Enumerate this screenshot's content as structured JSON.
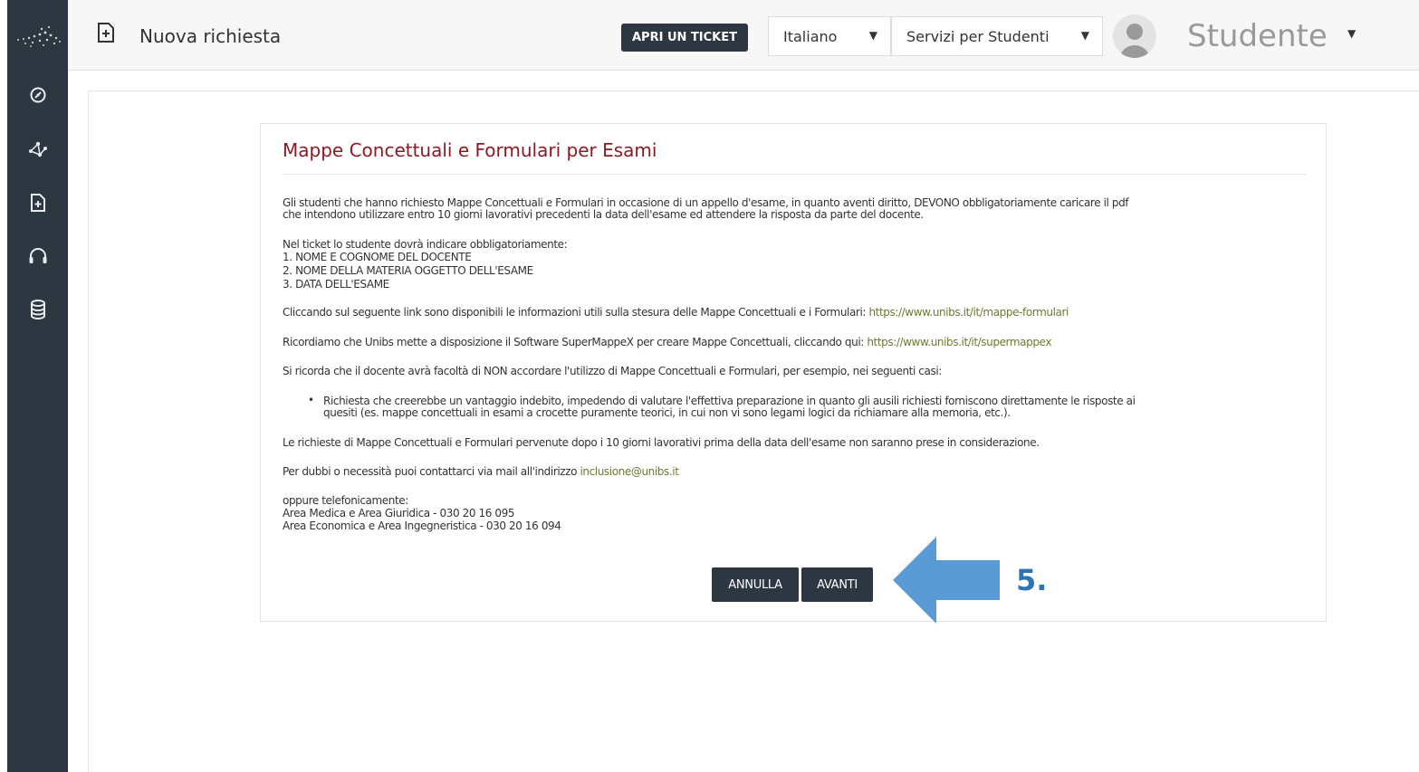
{
  "header": {
    "title": "Nuova richiesta",
    "ticket_button": "APRI UN TICKET",
    "language_select": "Italiano",
    "service_select": "Servizi per Studenti",
    "user_name": "Studente"
  },
  "panel": {
    "title": "Mappe Concettuali e Formulari per Esami",
    "intro_line1": "Gli studenti che hanno richiesto Mappe Concettuali e Formulari in occasione di un appello d'esame, in quanto aventi diritto, DEVONO obbligatoriamente caricare il pdf",
    "intro_line2": "che intendono utilizzare entro 10 giorni lavorativi precedenti la data dell'esame ed attendere la risposta da parte del docente.",
    "ticket_heading": "Nel ticket lo studente dovrà indicare obbligatoriamente:",
    "ticket_item1": "1. NOME E COGNOME DEL DOCENTE",
    "ticket_item2": "2. NOME DELLA MATERIA OGGETTO DELL'ESAME",
    "ticket_item3": "3. DATA DELL'ESAME",
    "info_text": "Cliccando sul seguente link sono disponibili le informazioni utili sulla stesura delle Mappe Concettuali e i Formulari: ",
    "info_link": "https://www.unibs.it/it/mappe-formulari",
    "software_text": "Ricordiamo che Unibs mette a disposizione il Software SuperMappeX per creare Mappe Concettuali, cliccando qui: ",
    "software_link": "https://www.unibs.it/it/supermappex",
    "note_text": "Si ricorda che il docente avrà facoltà di NON accordare l'utilizzo di Mappe Concettuali e Formulari, per esempio, nei seguenti casi:",
    "bullet_line1": "Richiesta che creerebbe un vantaggio indebito, impedendo di valutare l'effettiva preparazione in quanto gli ausili richiesti forniscono direttamente le risposte ai",
    "bullet_line2": "quesiti (es. mappe concettuali in esami a crocette puramente teorici, in cui non vi sono legami logici da richiamare alla memoria, etc.).",
    "late_text": "Le richieste di Mappe Concettuali e Formulari pervenute dopo i 10 giorni lavorativi prima della data dell'esame non saranno prese in considerazione.",
    "contact_text": "Per dubbi o necessità puoi contattarci via mail all'indirizzo ",
    "contact_email": "inclusione@unibs.it",
    "phone_heading": "oppure telefonicamente:",
    "phone_line1": "Area Medica e Area Giuridica - 030 20 16 095",
    "phone_line2": "Area Economica e Area Ingegneristica - 030 20 16 094",
    "cancel_button": "ANNULLA",
    "next_button": "AVANTI"
  },
  "annotation": {
    "step_label": "5.",
    "arrow_color": "#5b9bd5"
  },
  "icons": {
    "sidebar": [
      "dashboard-icon",
      "network-icon",
      "new-request-icon",
      "support-icon",
      "database-icon"
    ]
  },
  "colors": {
    "sidebar_bg": "#2d3742",
    "title_red": "#8b1a24",
    "link_green": "#6b7a33",
    "step_blue": "#2e75b6"
  }
}
